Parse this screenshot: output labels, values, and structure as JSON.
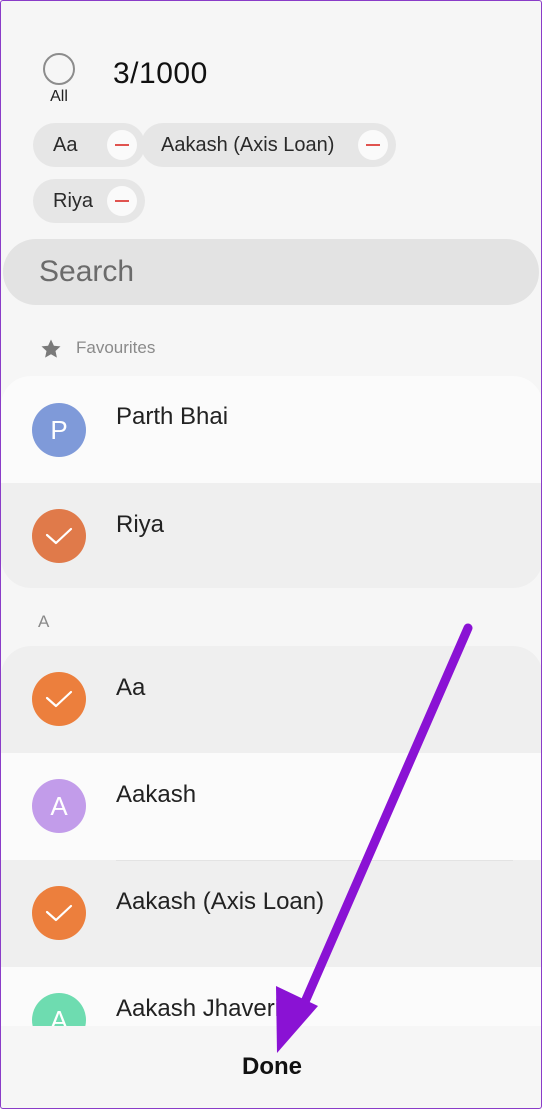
{
  "header": {
    "all_label": "All",
    "count": "3/1000"
  },
  "chips": [
    {
      "label": "Aa"
    },
    {
      "label": "Aakash (Axis Loan)"
    },
    {
      "label": "Riya"
    }
  ],
  "search": {
    "placeholder": "Search"
  },
  "sections": {
    "favourites": {
      "title": "Favourites",
      "contacts": [
        {
          "name": "Parth Bhai",
          "initial": "P",
          "selected": false,
          "color": "#7f9ad9"
        },
        {
          "name": "Riya",
          "initial": "",
          "selected": true,
          "color": "#e07a4a"
        }
      ]
    },
    "a": {
      "title": "A",
      "contacts": [
        {
          "name": "Aa",
          "initial": "",
          "selected": true,
          "color": "#ec7f3d"
        },
        {
          "name": "Aakash",
          "initial": "A",
          "selected": false,
          "color": "#c29cea"
        },
        {
          "name": "Aakash (Axis Loan)",
          "initial": "",
          "selected": true,
          "color": "#ec7f3d"
        },
        {
          "name": "Aakash Jhaveri",
          "initial": "A",
          "selected": false,
          "color": "#6edcb0"
        }
      ]
    }
  },
  "footer": {
    "done_label": "Done"
  },
  "annotation": {
    "arrow_color": "#8a12d4"
  }
}
